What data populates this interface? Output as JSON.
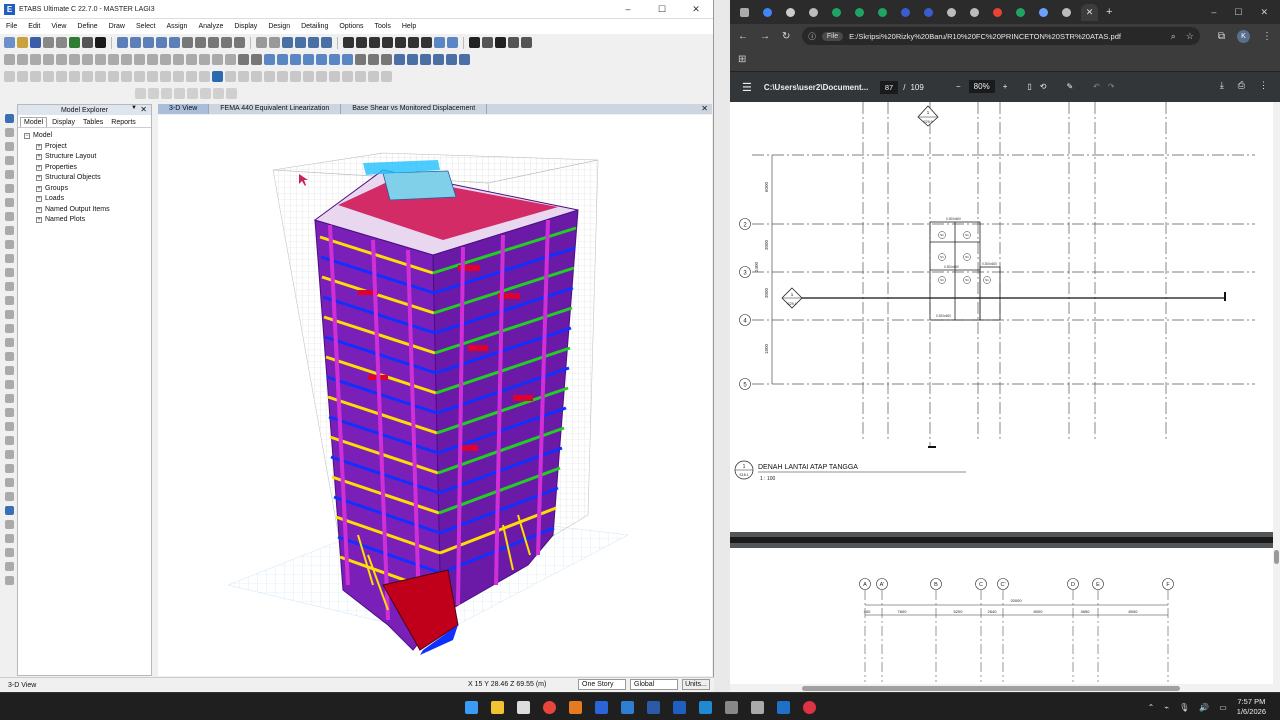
{
  "etabs": {
    "title": "ETABS Ultimate C 22.7.0 - MASTER LAGI3",
    "menu": [
      "File",
      "Edit",
      "View",
      "Define",
      "Draw",
      "Select",
      "Assign",
      "Analyze",
      "Display",
      "Design",
      "Detailing",
      "Options",
      "Tools",
      "Help"
    ],
    "explorer": {
      "title": "Model Explorer",
      "tabs": [
        "Model",
        "Display",
        "Tables",
        "Reports"
      ],
      "root": "Model",
      "items": [
        "Project",
        "Structure Layout",
        "Properties",
        "Structural Objects",
        "Groups",
        "Loads",
        "Named Output Items",
        "Named Plots"
      ]
    },
    "view_tabs": [
      "3-D View",
      "FEMA 440 Equivalent Linearization",
      "Base Shear vs Monitored Displacement"
    ],
    "status": {
      "left": "3-D View",
      "coords": "X 15  Y 28.46  Z 69.55 (m)",
      "story": "One Story",
      "coord_sys": "Global",
      "units": "Units..."
    }
  },
  "chrome": {
    "url": "E:/Skripsi%20Rizky%20Baru/R10%20FC%20PRINCETON%20STR%20ATAS.pdf",
    "file_chip": "File",
    "avatar": "K"
  },
  "pdf": {
    "filename": "C:\\Users\\user2\\Document...",
    "page_current": "87",
    "page_total": "109",
    "zoom": "80%",
    "drawing": {
      "detail_mark_top": "1",
      "detail_sheet_top": "S29.9",
      "section_mark": "1",
      "section_sheet": "S29.1",
      "rows": [
        "2",
        "3",
        "4",
        "5"
      ],
      "dims_left": [
        "6000",
        "3000",
        "2400",
        "3000",
        "1800"
      ],
      "beam_top": "0.300x600",
      "beam_mid": "0.300x600",
      "beam_bot": "0.300x600",
      "beam_right": "0.300x600",
      "slab": "S1",
      "title_no": "1",
      "title_sheet": "S18.1",
      "title": "DENAH LANTAI ATAP TANGGA",
      "scale": "1 : 100",
      "cols": [
        "A",
        "A'",
        "B",
        "C",
        "C'",
        "D",
        "E",
        "F"
      ],
      "dims_bottom": [
        "400",
        "7600",
        "5200",
        "2640",
        "8000",
        "3650",
        "8000"
      ],
      "dim_total": "20000"
    }
  },
  "taskbar": {
    "time": "7:57 PM",
    "date": "1/6/2026"
  }
}
